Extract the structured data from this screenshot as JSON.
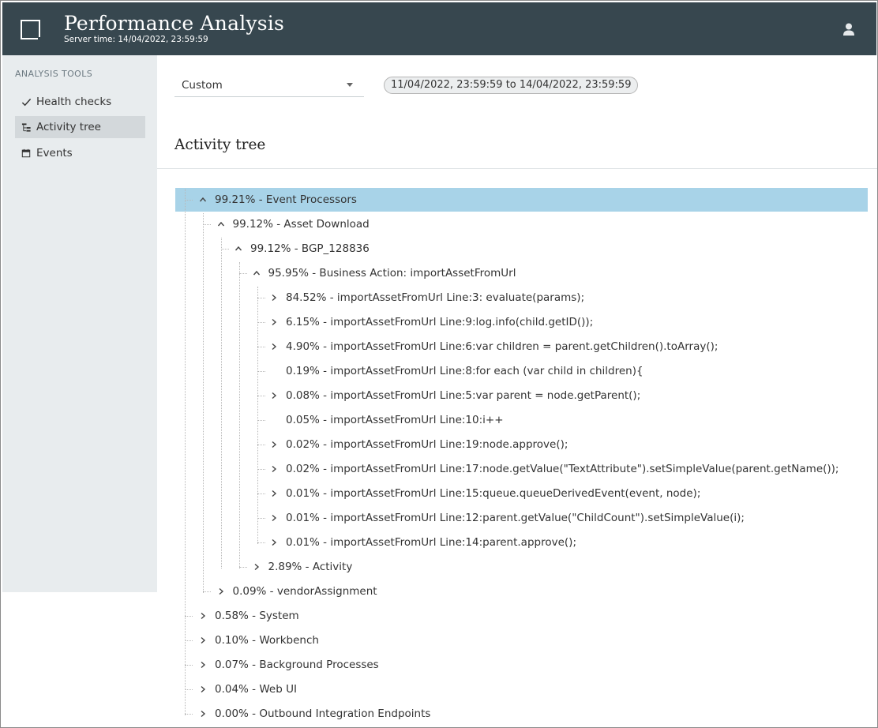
{
  "header": {
    "title": "Performance Analysis",
    "server_time": "Server time: 14/04/2022, 23:59:59",
    "user_icon": "user-icon"
  },
  "sidebar": {
    "heading": "ANALYSIS TOOLS",
    "items": [
      {
        "label": "Health checks",
        "icon": "check-icon",
        "active": false
      },
      {
        "label": "Activity tree",
        "icon": "tree-icon",
        "active": true
      },
      {
        "label": "Events",
        "icon": "calendar-icon",
        "active": false
      }
    ]
  },
  "filter": {
    "period": "Custom",
    "range": "11/04/2022, 23:59:59 to 14/04/2022, 23:59:59"
  },
  "section_title": "Activity tree",
  "tree": [
    {
      "label": "99.21% - Event Processors",
      "level": 0,
      "state": "expanded",
      "selected": true
    },
    {
      "label": "99.12% - Asset Download",
      "level": 1,
      "state": "expanded"
    },
    {
      "label": "99.12% - BGP_128836",
      "level": 2,
      "state": "expanded"
    },
    {
      "label": "95.95% - Business Action: importAssetFromUrl",
      "level": 3,
      "state": "expanded"
    },
    {
      "label": "84.52% - importAssetFromUrl Line:3: evaluate(params);",
      "level": 4,
      "state": "collapsed"
    },
    {
      "label": "6.15% - importAssetFromUrl Line:9:log.info(child.getID());",
      "level": 4,
      "state": "collapsed"
    },
    {
      "label": "4.90% - importAssetFromUrl Line:6:var children = parent.getChildren().toArray();",
      "level": 4,
      "state": "collapsed"
    },
    {
      "label": "0.19% - importAssetFromUrl Line:8:for each (var child in children){",
      "level": 4,
      "state": "leaf"
    },
    {
      "label": "0.08% - importAssetFromUrl Line:5:var parent = node.getParent();",
      "level": 4,
      "state": "collapsed"
    },
    {
      "label": "0.05% - importAssetFromUrl Line:10:i++",
      "level": 4,
      "state": "leaf"
    },
    {
      "label": "0.02% - importAssetFromUrl Line:19:node.approve();",
      "level": 4,
      "state": "collapsed"
    },
    {
      "label": "0.02% - importAssetFromUrl Line:17:node.getValue(\"TextAttribute\").setSimpleValue(parent.getName());",
      "level": 4,
      "state": "collapsed"
    },
    {
      "label": "0.01% - importAssetFromUrl Line:15:queue.queueDerivedEvent(event, node);",
      "level": 4,
      "state": "collapsed"
    },
    {
      "label": "0.01% - importAssetFromUrl Line:12:parent.getValue(\"ChildCount\").setSimpleValue(i);",
      "level": 4,
      "state": "collapsed"
    },
    {
      "label": "0.01% - importAssetFromUrl Line:14:parent.approve();",
      "level": 4,
      "state": "collapsed"
    },
    {
      "label": "2.89% - Activity",
      "level": 3,
      "state": "collapsed"
    },
    {
      "label": "0.09% - vendorAssignment",
      "level": 1,
      "state": "collapsed"
    },
    {
      "label": "0.58% - System",
      "level": 0,
      "state": "collapsed"
    },
    {
      "label": "0.10% - Workbench",
      "level": 0,
      "state": "collapsed"
    },
    {
      "label": "0.07% - Background Processes",
      "level": 0,
      "state": "collapsed"
    },
    {
      "label": "0.04% - Web UI",
      "level": 0,
      "state": "collapsed"
    },
    {
      "label": "0.00% - Outbound Integration Endpoints",
      "level": 0,
      "state": "collapsed"
    }
  ],
  "colors": {
    "header_bg": "#37474f",
    "sidebar_bg": "#e8ecee",
    "selected_row": "#a8d3e8"
  }
}
